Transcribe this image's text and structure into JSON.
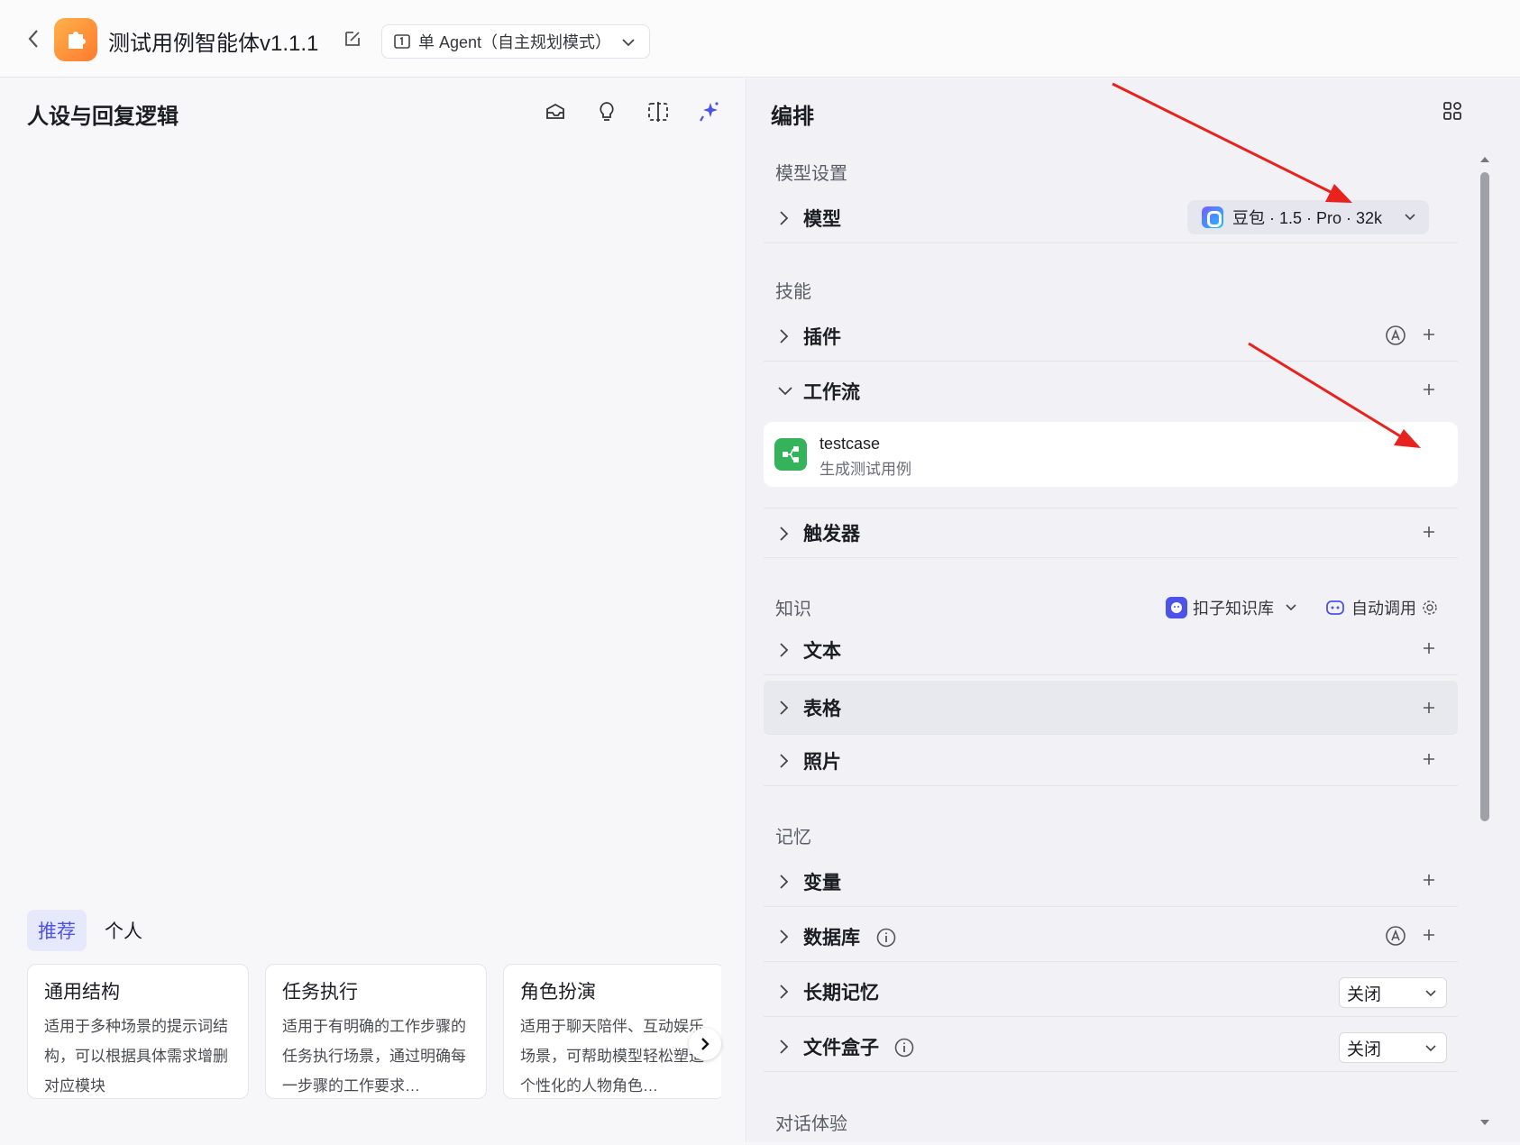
{
  "header": {
    "app_title": "测试用例智能体v1.1.1",
    "mode_label": "单 Agent（自主规划模式）"
  },
  "left_panel": {
    "title": "人设与回复逻辑",
    "tabs": [
      "推荐",
      "个人"
    ],
    "cards": [
      {
        "title": "通用结构",
        "desc": "适用于多种场景的提示词结构，可以根据具体需求增删对应模块"
      },
      {
        "title": "任务执行",
        "desc": "适用于有明确的工作步骤的任务执行场景，通过明确每一步骤的工作要求…"
      },
      {
        "title": "角色扮演",
        "desc": "适用于聊天陪伴、互动娱乐场景，可帮助模型轻松塑造个性化的人物角色…"
      }
    ]
  },
  "right_panel": {
    "title": "编排",
    "sections": {
      "model_settings": "模型设置",
      "skills": "技能",
      "knowledge": "知识",
      "memory": "记忆",
      "dialog": "对话体验"
    },
    "model": {
      "label": "模型",
      "value": "豆包 · 1.5 · Pro · 32k"
    },
    "skills": {
      "plugin": "插件",
      "workflow": "工作流",
      "trigger": "触发器"
    },
    "workflow_item": {
      "name": "testcase",
      "desc": "生成测试用例"
    },
    "knowledge": {
      "kb_source": "扣子知识库",
      "auto_call": "自动调用",
      "text": "文本",
      "table": "表格",
      "photo": "照片"
    },
    "memory": {
      "variable": "变量",
      "database": "数据库",
      "long_memory": "长期记忆",
      "long_memory_value": "关闭",
      "file_box": "文件盒子",
      "file_box_value": "关闭"
    }
  },
  "colors": {
    "accent": "#4d53e8",
    "arrow": "#e8231f",
    "workflow": "#34b35a"
  }
}
